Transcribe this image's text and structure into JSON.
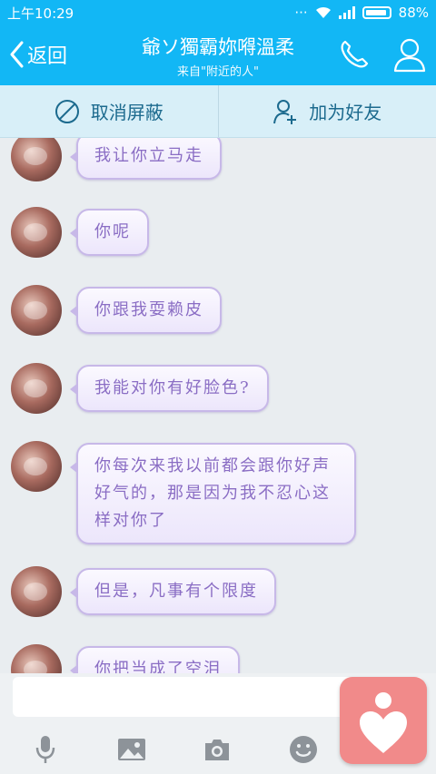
{
  "status": {
    "time": "上午10:29",
    "signal_dots": "···",
    "battery": "88%"
  },
  "header": {
    "back_label": "返回",
    "contact_name": "爺ソ獨霸妳嘚溫柔",
    "subtitle": "来自\"附近的人\""
  },
  "actions": {
    "unblock_label": "取消屏蔽",
    "add_friend_label": "加为好友"
  },
  "messages": [
    {
      "text": "我让你立马走"
    },
    {
      "text": "你呢"
    },
    {
      "text": "你跟我耍赖皮"
    },
    {
      "text": "我能对你有好脸色?"
    },
    {
      "text": "你每次来我以前都会跟你好声好气的，那是因为我不忍心这样对你了"
    },
    {
      "text": "但是，凡事有个限度"
    },
    {
      "text": "你把当成了空泪"
    }
  ],
  "input": {
    "placeholder": ""
  },
  "colors": {
    "header_bg": "#12b7f5",
    "action_bar_bg": "#d8eff8",
    "bubble_text": "#8a6dc4",
    "float_button": "#f18a8a"
  }
}
